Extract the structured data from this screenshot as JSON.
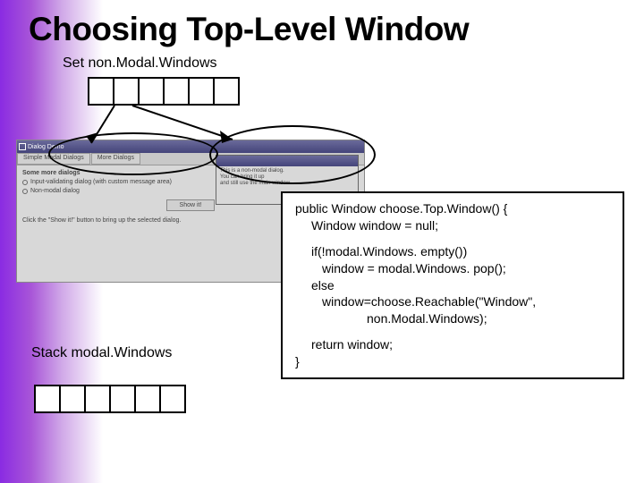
{
  "title": "Choosing Top-Level Window",
  "labels": {
    "set": "Set non.Modal.Windows",
    "stack": "Stack modal.Windows"
  },
  "screenshot": {
    "window_title": "Dialog Demo",
    "tab1": "Simple Modal Dialogs",
    "tab2": "More Dialogs",
    "heading": "Some more dialogs",
    "radio1": "Input-validating dialog (with custom message area)",
    "radio2": "Non-modal dialog",
    "button": "Show it!",
    "footer": "Click the \"Show it!\" button to bring up the selected dialog.",
    "inner_line1": "This is a non-modal dialog.",
    "inner_line2": "You can bring it up",
    "inner_line3": "and still use the main window."
  },
  "code": {
    "l1": "public Window choose.Top.Window() {",
    "l2": "Window window = null;",
    "l3": "if(!modal.Windows. empty())",
    "l4": "window = modal.Windows. pop();",
    "l5": "else",
    "l6": "window=choose.Reachable(\"Window\",",
    "l7": "non.Modal.Windows);",
    "l8": "return window;",
    "l9": "}"
  }
}
